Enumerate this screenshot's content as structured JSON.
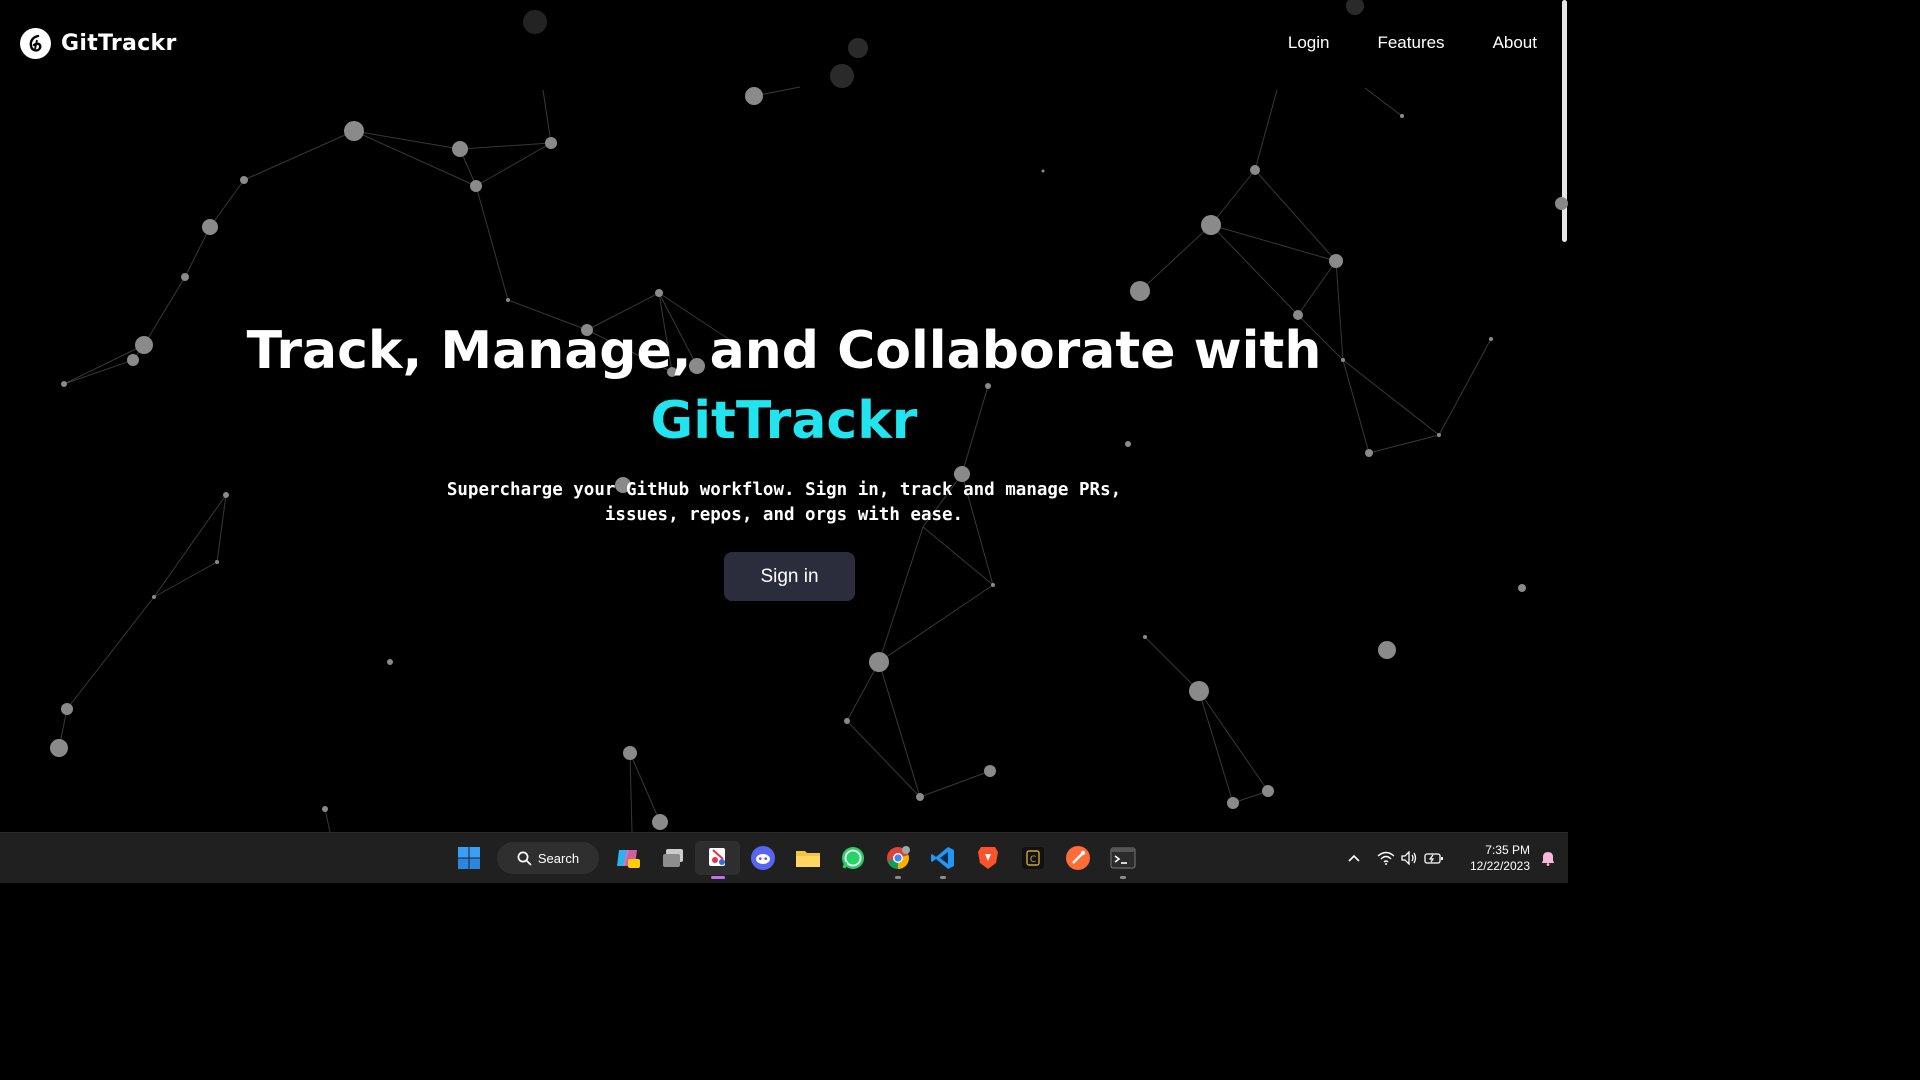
{
  "app": {
    "name": "GitTrackr"
  },
  "nav": {
    "links": [
      "Login",
      "Features",
      "About"
    ]
  },
  "hero": {
    "title_line1": "Track, Manage, and Collaborate with",
    "title_brand": "GitTrackr",
    "subtitle": "Supercharge your GitHub workflow. Sign in, track and manage PRs, issues, repos, and orgs with ease.",
    "cta": "Sign in"
  },
  "colors": {
    "accent": "#22e4ee",
    "button": "#2b2d3d",
    "background": "#000000"
  },
  "taskbar": {
    "search_label": "Search",
    "apps": [
      "windows-start-icon",
      "copilot-icon",
      "task-view-icon",
      "snipping-tool-icon",
      "discord-icon",
      "file-explorer-icon",
      "whatsapp-icon",
      "chrome-icon",
      "vscode-icon",
      "brave-icon",
      "terminal-app-icon",
      "postman-icon",
      "windows-terminal-icon"
    ],
    "time": "7:35 PM",
    "date": "12/22/2023"
  }
}
